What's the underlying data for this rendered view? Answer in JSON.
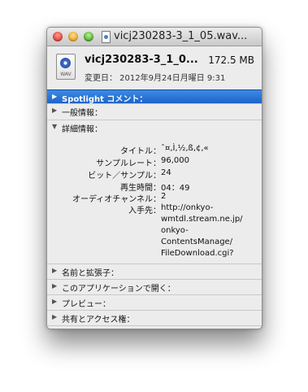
{
  "window": {
    "title": "vicj230283-3_1_05.wav..."
  },
  "header": {
    "file_name": "vicj230283-3_1_0...",
    "file_size": "172.5 MB",
    "modified": "変更日： 2012年9月24日月曜日 9:31",
    "file_icon_ext": "WAV"
  },
  "sections": {
    "spotlight": "Spotlight コメント：",
    "general": "一般情報：",
    "more_info": "詳細情報：",
    "name_ext": "名前と拡張子：",
    "open_with": "このアプリケーションで開く：",
    "preview": "プレビュー：",
    "sharing": "共有とアクセス権："
  },
  "details": [
    {
      "key": "タイトル：",
      "value": "ˆ¤,Ì,½,ß,¢,«"
    },
    {
      "key": "サンプルレート：",
      "value": "96,000"
    },
    {
      "key": "ビット／サンプル：",
      "value": "24"
    },
    {
      "key": "再生時間：",
      "value": "04：49"
    },
    {
      "key": "オーディオチャンネル：",
      "value": "2"
    },
    {
      "key": "入手先：",
      "value": "http://onkyo-"
    }
  ],
  "where_from_lines": [
    "wmtdl.stream.ne.jp/",
    "onkyo-",
    "ContentsManage/",
    "FileDownload.cgi?"
  ],
  "icons": {
    "close": "close-icon",
    "minimize": "minimize-icon",
    "zoom": "zoom-icon",
    "collapsed": "triangle-right-icon",
    "expanded": "triangle-down-icon"
  },
  "colors": {
    "spotlight_bg": "#2a74d8",
    "window_bg": "#ececec"
  }
}
